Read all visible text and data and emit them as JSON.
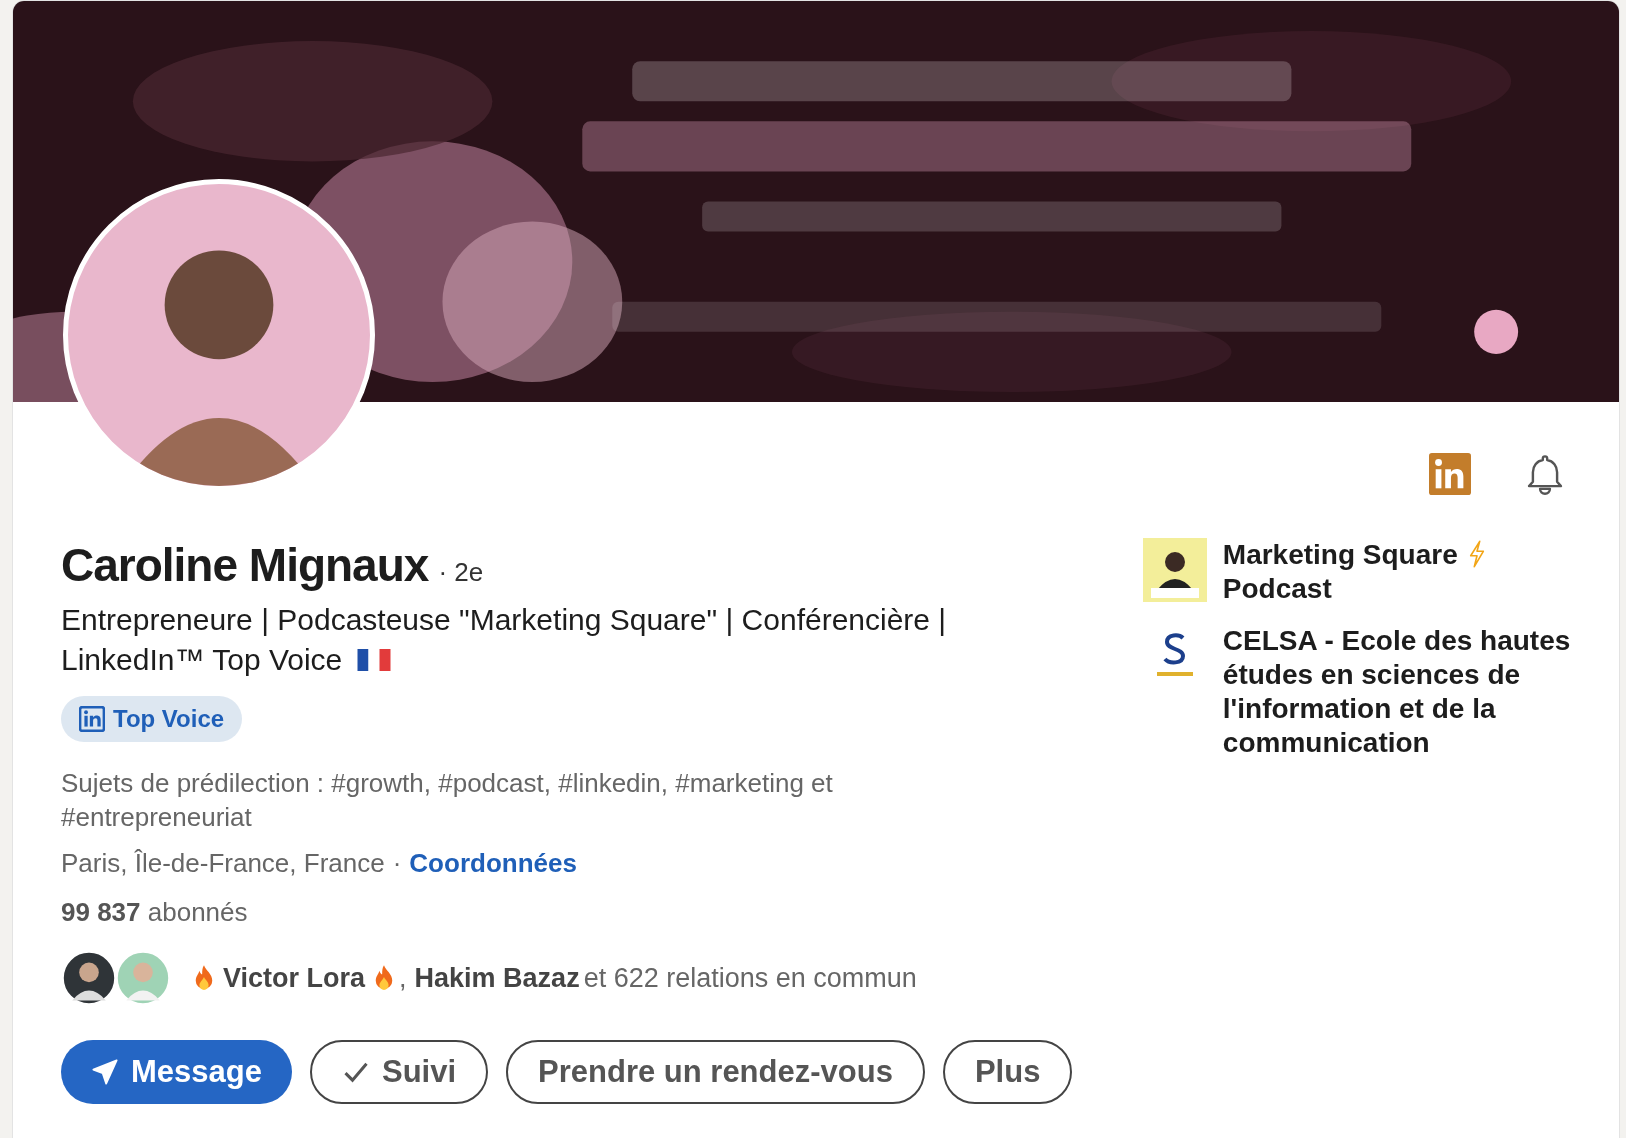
{
  "profile": {
    "name": "Caroline Mignaux",
    "degree": "· 2e",
    "headline_lines": [
      "Entrepreneure | Podcasteuse \"Marketing Square\" | Conférencière |",
      "LinkedIn™ Top Voice"
    ],
    "badge": "Top Voice",
    "topics": "Sujets de prédilection : #growth, #podcast, #linkedin, #marketing et #entrepreneuriat",
    "location": "Paris, Île-de-France, France",
    "location_separator": "·",
    "contact_link": "Coordonnées",
    "followers": "**99 837** abonnés",
    "mutual": {
      "first": "Victor Lora",
      "separator": ",",
      "second": "Hakim Bazaz",
      "rest": "et 622 relations en commun"
    }
  },
  "experience": [
    {
      "kind": "podcast",
      "label": "Marketing Square",
      "suffix": "Podcast"
    },
    {
      "kind": "school",
      "label": "CELSA - Ecole des hautes études en sciences de l'information et de la communication"
    }
  ],
  "actions": [
    {
      "label": "Message",
      "kind": "primary"
    },
    {
      "label": "Suivi",
      "kind": "check"
    },
    {
      "label": "Prendre un rendez-vous",
      "kind": "outline"
    },
    {
      "label": "Plus",
      "kind": "outline"
    }
  ]
}
